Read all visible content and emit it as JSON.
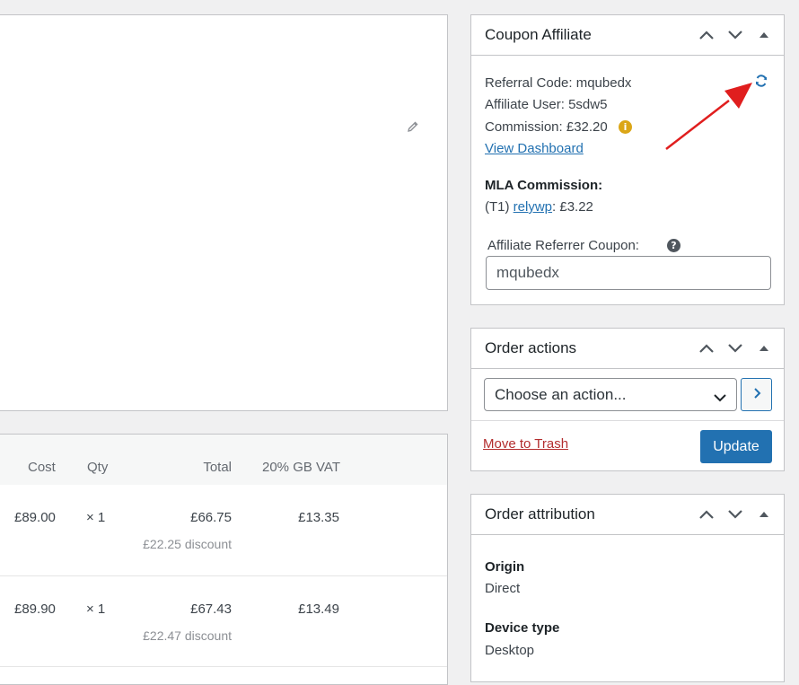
{
  "coupon_affiliate": {
    "title": "Coupon Affiliate",
    "referral_code_text": "Referral Code: mqubedx",
    "affiliate_user_text": "Affiliate User: 5sdw5",
    "commission_text": "Commission: £32.20",
    "view_dashboard_label": "View Dashboard",
    "mla_heading": "MLA Commission:",
    "mla_tier": "(T1)",
    "mla_user": "relywp",
    "mla_amount": ": £3.22",
    "referrer_coupon_label": "Affiliate Referrer Coupon:",
    "referrer_coupon_value": "mqubedx"
  },
  "order_actions": {
    "title": "Order actions",
    "select_value": "Choose an action...",
    "trash_label": "Move to Trash",
    "update_label": "Update"
  },
  "order_attribution": {
    "title": "Order attribution",
    "origin_label": "Origin",
    "origin_value": "Direct",
    "device_label": "Device type",
    "device_value": "Desktop"
  },
  "items_table": {
    "headers": {
      "cost": "Cost",
      "qty": "Qty",
      "total": "Total",
      "tax": "20% GB VAT"
    },
    "rows": [
      {
        "cost": "£89.00",
        "qty": "× 1",
        "total": "£66.75",
        "discount": "£22.25 discount",
        "tax": "£13.35"
      },
      {
        "cost": "£89.90",
        "qty": "× 1",
        "total": "£67.43",
        "discount": "£22.47 discount",
        "tax": "£13.49"
      }
    ]
  },
  "icons": [
    "pencil-icon",
    "refresh-icon",
    "info-icon",
    "help-icon",
    "chevron-up-icon",
    "chevron-down-icon",
    "triangle-up-icon",
    "arrow-right-icon"
  ],
  "colors": {
    "accent": "#2271b1",
    "trash": "#b32d2e",
    "info": "#dba617",
    "annotation_arrow": "#e01e1e"
  }
}
